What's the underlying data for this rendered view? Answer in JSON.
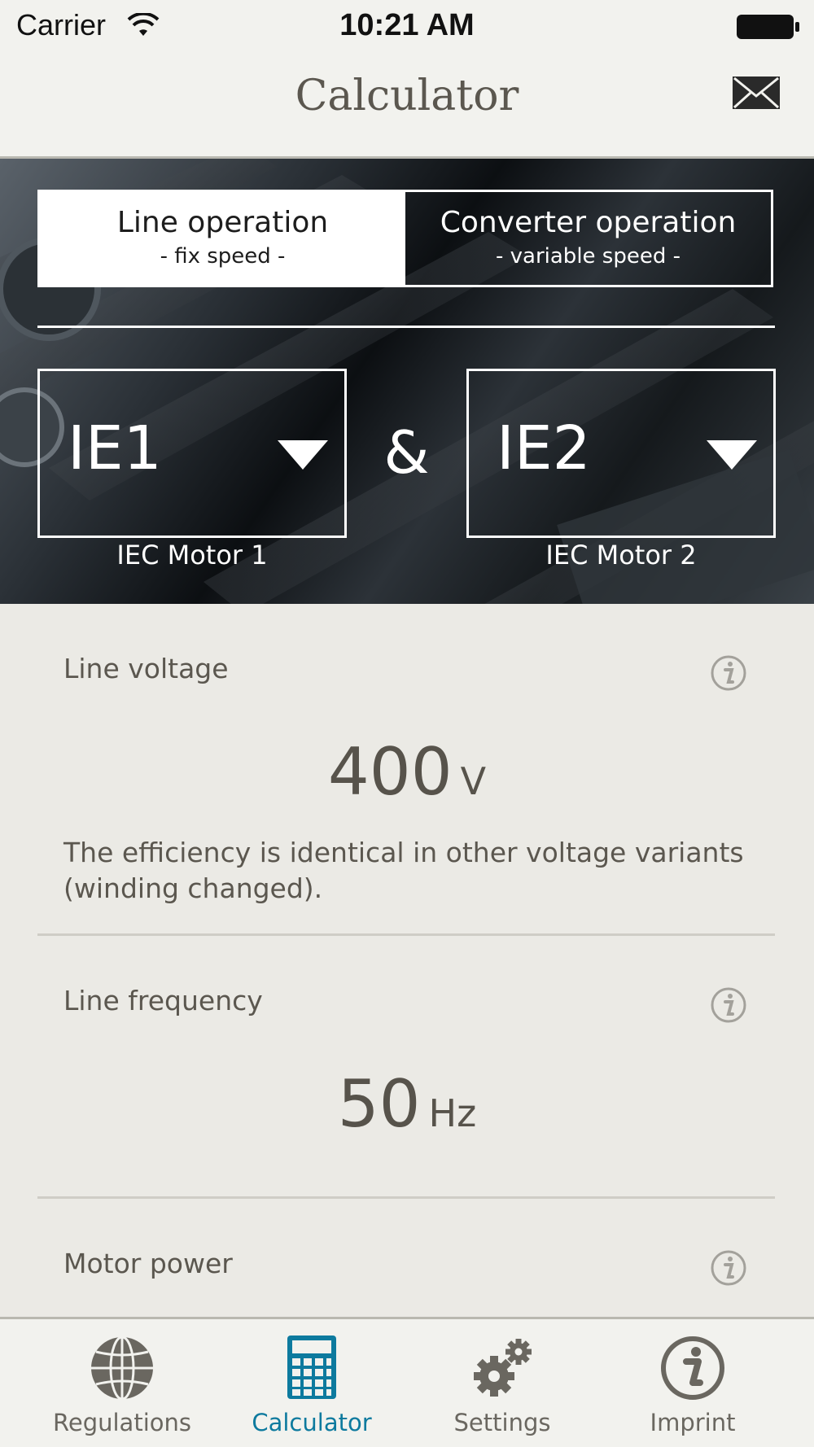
{
  "status_bar": {
    "carrier": "Carrier",
    "time": "10:21 AM",
    "wifi_icon": "wifi-icon",
    "battery_icon": "battery-icon"
  },
  "nav": {
    "title": "Calculator",
    "mail_icon": "mail-icon"
  },
  "operation_modes": [
    {
      "title": "Line operation",
      "subtitle": "- fix speed -",
      "selected": true
    },
    {
      "title": "Converter operation",
      "subtitle": "- variable speed -",
      "selected": false
    }
  ],
  "motors": {
    "motor1": {
      "value": "IE1",
      "caption": "IEC Motor 1"
    },
    "connector": "&",
    "motor2": {
      "value": "IE2",
      "caption": "IEC Motor 2"
    }
  },
  "parameters": {
    "line_voltage": {
      "label": "Line voltage",
      "value": "400",
      "unit": "V",
      "note": "The efficiency is identical in other voltage variants (winding changed)."
    },
    "line_frequency": {
      "label": "Line frequency",
      "value": "50",
      "unit": "Hz"
    },
    "motor_power": {
      "label": "Motor power"
    }
  },
  "tabs": [
    {
      "label": "Regulations",
      "icon": "globe-icon",
      "active": false
    },
    {
      "label": "Calculator",
      "icon": "calculator-icon",
      "active": true
    },
    {
      "label": "Settings",
      "icon": "gears-icon",
      "active": false
    },
    {
      "label": "Imprint",
      "icon": "info-icon",
      "active": false
    }
  ],
  "colors": {
    "accent": "#0d7a9e",
    "text": "#5b574f",
    "background": "#ebeae5",
    "bar": "#f2f2ee"
  }
}
